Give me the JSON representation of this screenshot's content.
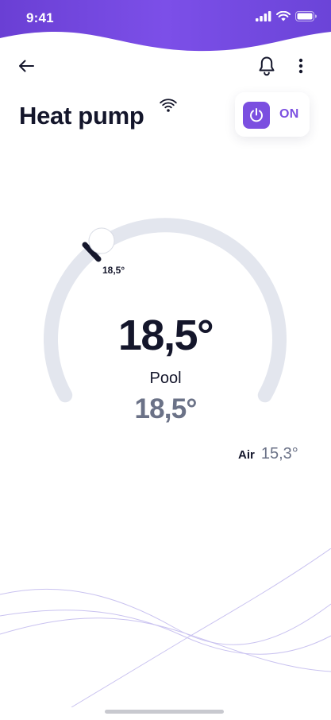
{
  "status_bar": {
    "time": "9:41"
  },
  "header": {
    "title": "Heat pump"
  },
  "power": {
    "state_label": "ON"
  },
  "thermostat": {
    "setpoint": "18,5°",
    "handle_label": "18,5°",
    "pool_label": "Pool",
    "pool_temp": "18,5°"
  },
  "air": {
    "label": "Air",
    "value": "15,3°"
  },
  "colors": {
    "accent": "#7b4fe0",
    "header_gradient_start": "#6a3fd4",
    "header_gradient_end": "#8a5ef0",
    "gauge_track": "#e3e6ee",
    "text_primary": "#14162b",
    "text_secondary": "#6b7287"
  },
  "icons": {
    "back": "arrow-left-icon",
    "notifications": "bell-icon",
    "more": "more-vertical-icon",
    "connectivity": "wifi-icon",
    "power": "power-icon"
  }
}
